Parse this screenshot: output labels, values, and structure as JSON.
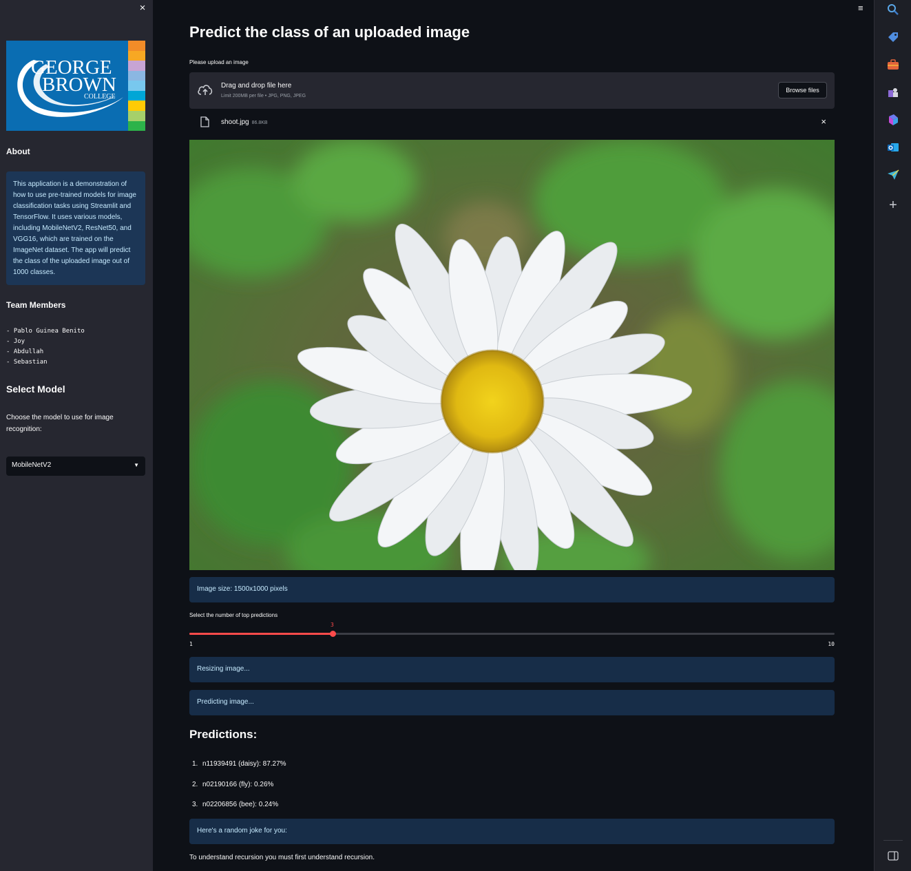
{
  "sidebar": {
    "close_glyph": "×",
    "logo": {
      "line1": "GEORGE",
      "line2": "BROWN",
      "line3": "COLLEGE",
      "stripe_colors": [
        "#f28c28",
        "#f7a823",
        "#c7a4d4",
        "#8bb7e2",
        "#78c8ee",
        "#00a6d6",
        "#ffcb05",
        "#a6d06a",
        "#2db34a"
      ]
    },
    "about_heading": "About",
    "about_text": "This application is a demonstration of how to use pre-trained models for image classification tasks using Streamlit and TensorFlow. It uses various models, including MobileNetV2, ResNet50, and VGG16, which are trained on the ImageNet dataset. The app will predict the class of the uploaded image out of 1000 classes.",
    "team_heading": "Team Members",
    "members": [
      "- Pablo Guinea Benito",
      "- Joy",
      "- Abdullah",
      "- Sebastian"
    ],
    "select_heading": "Select Model",
    "select_label": "Choose the model to use for image recognition:",
    "selected_model": "MobileNetV2",
    "caret": "▼"
  },
  "main": {
    "menu_glyph": "≡",
    "title": "Predict the class of an uploaded image",
    "upload_label": "Please upload an image",
    "dropzone_title": "Drag and drop file here",
    "dropzone_sub": "Limit 200MB per file • JPG, PNG, JPEG",
    "browse_label": "Browse files",
    "file_name": "shoot.jpg",
    "file_size": "86.8KB",
    "file_remove": "×",
    "image_size_info": "Image size: 1500x1000 pixels",
    "slider": {
      "label": "Select the number of top predictions",
      "min": "1",
      "max": "10",
      "value": "3",
      "fraction": 0.2222
    },
    "resizing_info": "Resizing image...",
    "predicting_info": "Predicting image...",
    "predictions_heading": "Predictions:",
    "predictions": [
      {
        "num": "1.",
        "text": "n11939491 (daisy): 87.27%"
      },
      {
        "num": "2.",
        "text": "n02190166 (fly): 0.26%"
      },
      {
        "num": "3.",
        "text": "n02206856 (bee): 0.24%"
      }
    ],
    "joke_info": "Here's a random joke for you:",
    "joke_text": "To understand recursion you must first understand recursion."
  },
  "rail": {
    "icons": [
      "search-icon",
      "tag-icon",
      "briefcase-icon",
      "chess-icon",
      "copilot-icon",
      "outlook-icon",
      "send-icon",
      "add-icon",
      "sidebar-toggle-icon"
    ],
    "add_glyph": "+"
  },
  "colors": {
    "accent": "#ff4b4b",
    "info_bg": "#172d48",
    "info_text": "#c7ebff",
    "sidebar_bg": "#262730",
    "main_bg": "#0e1117"
  }
}
